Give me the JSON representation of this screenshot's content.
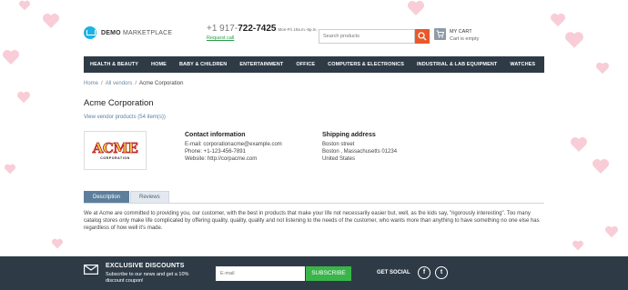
{
  "header": {
    "logo_bold": "DEMO",
    "logo_rest": "MARKETPLACE",
    "phone_prefix": "+1 917-",
    "phone_main": "722-7425",
    "phone_hours": "Mon-Fri 10a.m.-6p.m.",
    "request_call": "Request call",
    "search_placeholder": "Search products",
    "cart_label": "My cart",
    "cart_status": "Cart is empty"
  },
  "nav": {
    "items": [
      "Health & Beauty",
      "Home",
      "Baby & Children",
      "Entertainment",
      "Office",
      "Computers & Electronics",
      "Industrial & Lab Equipment",
      "Watches"
    ]
  },
  "breadcrumb": {
    "home": "Home",
    "all_vendors": "All vendors",
    "current": "Acme Corporation",
    "separator": "/"
  },
  "vendor": {
    "name": "Acme Corporation",
    "view_products": "View vendor products (54 item(s))",
    "logo_word": "ACME",
    "logo_sub": "CORPORATION",
    "contact_title": "Contact information",
    "email": "E-mail: corporationacme@example.com",
    "phone": "Phone: +1-123-456-7891",
    "website": "Website: http://corpacme.com",
    "shipping_title": "Shipping address",
    "street": "Boston street",
    "city": "Boston , Massachusetts 01234",
    "country": "United States"
  },
  "tabs": {
    "description": "Description",
    "reviews": "Reviews"
  },
  "description_text": "We at Acme are committed to providing you, our customer, with the best in products that make your life not necessarily easier but, well, as the kids say, \"rigorously interesting\". Too many catalog stores only make life complicated by offering quality, quality, quality and not listening to the needs of the customer, who wants more than anything to have something no one else has regardless of how well it's made.",
  "footer": {
    "exclusive_title": "Exclusive discounts",
    "exclusive_text": "Subscribe to our news and get a 10% discount coupon!",
    "email_placeholder": "E-mail",
    "subscribe": "Subscribe",
    "get_social": "Get social",
    "facebook_glyph": "f",
    "twitter_glyph": "t"
  },
  "colors": {
    "nav_bg": "#2e3b47",
    "accent_orange": "#e8582a",
    "accent_green": "#3ab54a",
    "tab_active": "#5d7f9c",
    "heart": "#f4a6b8"
  }
}
